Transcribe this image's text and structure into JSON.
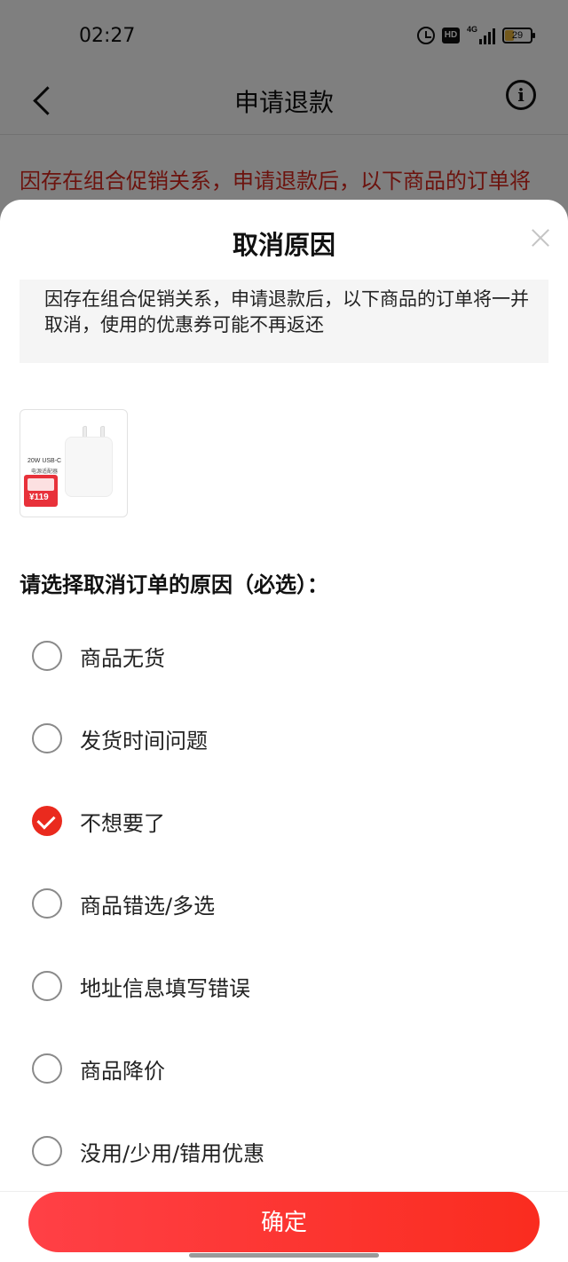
{
  "status_bar": {
    "time": "02:27",
    "hd_label": "HD",
    "network_label": "4G",
    "battery_level": "29",
    "icons": [
      "alarm-icon",
      "hd-icon",
      "signal-icon",
      "battery-icon"
    ]
  },
  "nav": {
    "title": "申请退款",
    "back_icon": "back-chevron-icon",
    "info_icon": "info-icon",
    "info_glyph": "i"
  },
  "background_notice": "因存在组合促销关系，申请退款后，以下商品的订单将",
  "sheet": {
    "title": "取消原因",
    "close_icon": "close-icon",
    "notice": "因存在组合促销关系，申请退款后，以下商品的订单将一并取消，使用的优惠券可能不再返还",
    "product": {
      "caption": "20W USB-C",
      "caption2": "电源适配器",
      "price": "¥119"
    },
    "reason_heading": "请选择取消订单的原因（必选）：",
    "reasons": [
      {
        "label": "商品无货",
        "checked": false
      },
      {
        "label": "发货时间问题",
        "checked": false
      },
      {
        "label": "不想要了",
        "checked": true
      },
      {
        "label": "商品错选/多选",
        "checked": false
      },
      {
        "label": "地址信息填写错误",
        "checked": false
      },
      {
        "label": "商品降价",
        "checked": false
      },
      {
        "label": "没用/少用/错用优惠",
        "checked": false
      }
    ],
    "confirm_label": "确定"
  },
  "colors": {
    "accent": "#ea2a1e",
    "notice_text": "#d8261c",
    "button_gradient_start": "#ff4046",
    "button_gradient_end": "#fa2c1f"
  }
}
